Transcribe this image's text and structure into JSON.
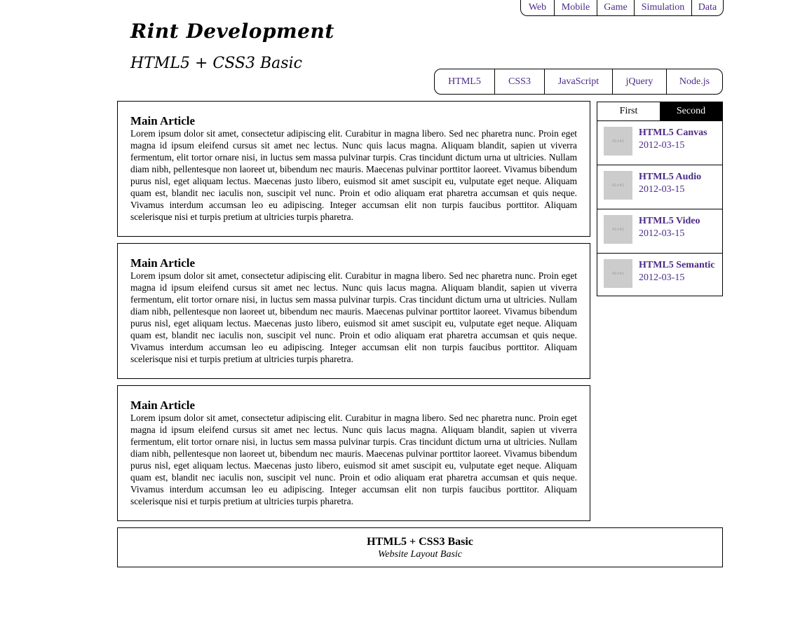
{
  "top_nav": [
    "Web",
    "Mobile",
    "Game",
    "Simulation",
    "Data"
  ],
  "header": {
    "title": "Rint Development",
    "subtitle": "HTML5 + CSS3 Basic"
  },
  "main_nav": [
    "HTML5",
    "CSS3",
    "JavaScript",
    "jQuery",
    "Node.js"
  ],
  "articles": [
    {
      "title": "Main Article",
      "body": "Lorem ipsum dolor sit amet, consectetur adipiscing elit. Curabitur in magna libero. Sed nec pharetra nunc. Proin eget magna id ipsum eleifend cursus sit amet nec lectus. Nunc quis lacus magna. Aliquam blandit, sapien ut viverra fermentum, elit tortor ornare nisi, in luctus sem massa pulvinar turpis. Cras tincidunt dictum urna ut ultricies. Nullam diam nibh, pellentesque non laoreet ut, bibendum nec mauris. Maecenas pulvinar porttitor laoreet. Vivamus bibendum purus nisl, eget aliquam lectus. Maecenas justo libero, euismod sit amet suscipit eu, vulputate eget neque. Aliquam quam est, blandit nec iaculis non, suscipit vel nunc. Proin et odio aliquam erat pharetra accumsan et quis neque. Vivamus interdum accumsan leo eu adipiscing. Integer accumsan elit non turpis faucibus porttitor. Aliquam scelerisque nisi et turpis pretium at ultricies turpis pharetra."
    },
    {
      "title": "Main Article",
      "body": "Lorem ipsum dolor sit amet, consectetur adipiscing elit. Curabitur in magna libero. Sed nec pharetra nunc. Proin eget magna id ipsum eleifend cursus sit amet nec lectus. Nunc quis lacus magna. Aliquam blandit, sapien ut viverra fermentum, elit tortor ornare nisi, in luctus sem massa pulvinar turpis. Cras tincidunt dictum urna ut ultricies. Nullam diam nibh, pellentesque non laoreet ut, bibendum nec mauris. Maecenas pulvinar porttitor laoreet. Vivamus bibendum purus nisl, eget aliquam lectus. Maecenas justo libero, euismod sit amet suscipit eu, vulputate eget neque. Aliquam quam est, blandit nec iaculis non, suscipit vel nunc. Proin et odio aliquam erat pharetra accumsan et quis neque. Vivamus interdum accumsan leo eu adipiscing. Integer accumsan elit non turpis faucibus porttitor. Aliquam scelerisque nisi et turpis pretium at ultricies turpis pharetra."
    },
    {
      "title": "Main Article",
      "body": "Lorem ipsum dolor sit amet, consectetur adipiscing elit. Curabitur in magna libero. Sed nec pharetra nunc. Proin eget magna id ipsum eleifend cursus sit amet nec lectus. Nunc quis lacus magna. Aliquam blandit, sapien ut viverra fermentum, elit tortor ornare nisi, in luctus sem massa pulvinar turpis. Cras tincidunt dictum urna ut ultricies. Nullam diam nibh, pellentesque non laoreet ut, bibendum nec mauris. Maecenas pulvinar porttitor laoreet. Vivamus bibendum purus nisl, eget aliquam lectus. Maecenas justo libero, euismod sit amet suscipit eu, vulputate eget neque. Aliquam quam est, blandit nec iaculis non, suscipit vel nunc. Proin et odio aliquam erat pharetra accumsan et quis neque. Vivamus interdum accumsan leo eu adipiscing. Integer accumsan elit non turpis faucibus porttitor. Aliquam scelerisque nisi et turpis pretium at ultricies turpis pharetra."
    }
  ],
  "sidebar": {
    "tabs": [
      "First",
      "Second"
    ],
    "active_tab": "Second",
    "thumb_text": "41×41",
    "items": [
      {
        "title": "HTML5 Canvas",
        "date": "2012-03-15"
      },
      {
        "title": "HTML5 Audio",
        "date": "2012-03-15"
      },
      {
        "title": "HTML5 Video",
        "date": "2012-03-15"
      },
      {
        "title": "HTML5 Semantic",
        "date": "2012-03-15"
      }
    ]
  },
  "footer": {
    "title": "HTML5 + CSS3 Basic",
    "subtitle": "Website Layout Basic"
  },
  "colors": {
    "link": "#4b2a86",
    "border": "#000000",
    "thumb_bg": "#cccccc",
    "active_tab_bg": "#000000"
  }
}
